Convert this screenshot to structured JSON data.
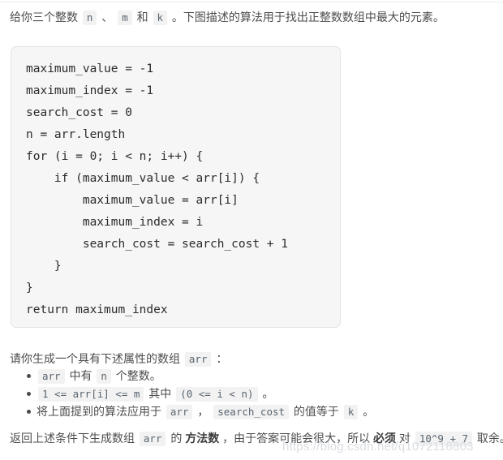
{
  "page": {
    "intro": {
      "seg1": "给你三个整数 ",
      "code_n": "n",
      "seg2": " 、 ",
      "code_m": "m",
      "seg3": " 和 ",
      "code_k": "k",
      "seg4": " 。下图描述的算法用于找出正整数数组中最大的元素。"
    },
    "code_block": {
      "language": "pseudocode",
      "lines": [
        "maximum_value = -1",
        "maximum_index = -1",
        "search_cost = 0",
        "n = arr.length",
        "for (i = 0; i < n; i++) {",
        "    if (maximum_value < arr[i]) {",
        "        maximum_value = arr[i]",
        "        maximum_index = i",
        "        search_cost = search_cost + 1",
        "    }",
        "}",
        "return maximum_index"
      ]
    },
    "array_prompt": {
      "seg1": "请你生成一个具有下述属性的数组 ",
      "code_arr": "arr",
      "seg2": " ："
    },
    "bullets": [
      {
        "seg1": "",
        "code_a": "arr",
        "seg2": " 中有 ",
        "code_b": "n",
        "seg3": " 个整数。",
        "code_c": "",
        "seg4": ""
      },
      {
        "seg1": "",
        "code_a": "1 <= arr[i] <= m",
        "seg2": " 其中 ",
        "code_b": "(0 <= i < n)",
        "seg3": " 。",
        "code_c": "",
        "seg4": ""
      },
      {
        "seg1": "将上面提到的算法应用于 ",
        "code_a": "arr",
        "seg2": " ， ",
        "code_b": "search_cost",
        "seg3": " 的值等于 ",
        "code_c": "k",
        "seg4": " 。"
      }
    ],
    "final_line": {
      "seg1": "返回上述条件下生成数组 ",
      "code_arr": "arr",
      "seg2": " 的 ",
      "bold_text": "方法数",
      "seg3": " ，由于答案可能会很大，所以 ",
      "bold_text2": "必须",
      "seg4": " 对 ",
      "code_mod": "10^9 + 7",
      "seg5": " 取余。"
    },
    "watermark": "https://blog.csdn.net/q1072118803",
    "colors": {
      "text": "#4d4d4d",
      "code_text": "#2b2b2b",
      "chip_bg": "#f2f2f2",
      "chip_text": "#5a6570",
      "code_block_bg": "#f6f6f6",
      "code_block_border": "#e3e3e3",
      "watermark": "#d9dde2"
    }
  }
}
